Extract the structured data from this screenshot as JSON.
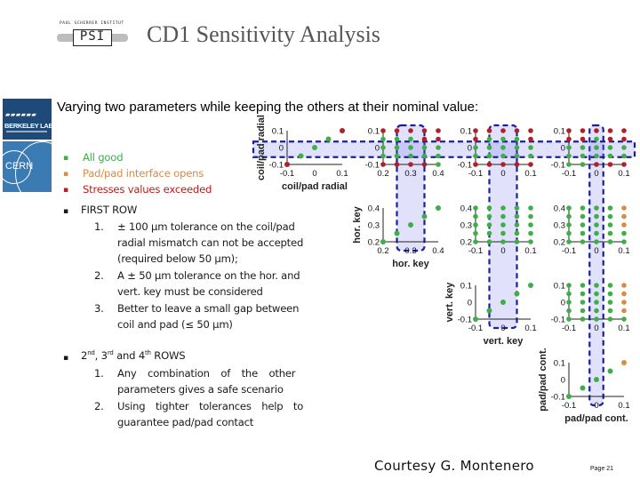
{
  "header": {
    "logo_top_text": "PAUL SCHERRER INSTITUT",
    "logo_mark": "PSI",
    "title": "CD1 Sensitivity Analysis"
  },
  "side_logos": {
    "berkeley": "BERKELEY LAB",
    "cern": "CERN"
  },
  "subtitle": "Varying two parameters while keeping the others at their nominal value:",
  "legend": [
    {
      "label": "All good",
      "color": "#3fae49"
    },
    {
      "label": "Pad/pad interface opens",
      "color": "#d98b45"
    },
    {
      "label": "Stresses values exceeded",
      "color": "#c01a1a"
    }
  ],
  "first_row": {
    "heading": "FIRST ROW",
    "items": [
      {
        "num": "1.",
        "lines": [
          "± 100 µm tolerance on the coil/pad",
          "radial mismatch can not be accepted",
          "(required below 50 µm);"
        ]
      },
      {
        "num": "2.",
        "lines": [
          "A ± 50 µm tolerance on the hor. and",
          "vert. key must be considered"
        ]
      },
      {
        "num": "3.",
        "lines": [
          "Better to leave a small gap between",
          "coil and pad (≤ 50 µm)"
        ]
      }
    ]
  },
  "other_rows": {
    "heading_parts": [
      "2",
      "nd",
      ", 3",
      "rd",
      " and 4",
      "th",
      " ROWS"
    ],
    "items": [
      {
        "num": "1.",
        "lines": [
          "Any combination of the other",
          "parameters gives a safe scenario"
        ]
      },
      {
        "num": "2.",
        "lines": [
          "Using tighter tolerances help to",
          "guarantee pad/pad contact"
        ]
      }
    ]
  },
  "courtesy": "Courtesy G. Montenero",
  "page": "Page 21",
  "chart_data": {
    "type": "scatter",
    "description": "Triangular matrix of 2-parameter sensitivity scans",
    "status_colors": {
      "good": "#3fae49",
      "open": "#d98b45",
      "stress": "#b0202a"
    },
    "parameters": [
      {
        "name": "coil/pad radial",
        "ticks": [
          "-0.1",
          "0",
          "0.1"
        ],
        "range": [
          -0.1,
          0.1
        ],
        "nominal_band": [
          -0.025,
          0.025
        ]
      },
      {
        "name": "hor. key",
        "ticks": [
          "0.2",
          "0.3",
          "0.4"
        ],
        "range": [
          0.2,
          0.4
        ],
        "nominal_band": [
          0.25,
          0.35
        ]
      },
      {
        "name": "vert. key",
        "ticks": [
          "-0.1",
          "0",
          "0.1"
        ],
        "range": [
          -0.1,
          0.1
        ],
        "nominal_band": [
          -0.05,
          0.05
        ]
      },
      {
        "name": "pad/pad cont.",
        "ticks": [
          "-0.1",
          "0",
          "0.1"
        ],
        "range": [
          -0.1,
          0.1
        ],
        "nominal_band": [
          -0.025,
          0.025
        ]
      }
    ],
    "diagonal": [
      {
        "param": 0,
        "status": [
          "stress",
          "good",
          "good",
          "good",
          "stress"
        ]
      },
      {
        "param": 1,
        "status": [
          "good",
          "good",
          "good",
          "good",
          "good"
        ]
      },
      {
        "param": 2,
        "status": [
          "good",
          "good",
          "good",
          "good",
          "good"
        ]
      },
      {
        "param": 3,
        "status": [
          "good",
          "good",
          "good",
          "good",
          "open"
        ]
      }
    ],
    "pairs": [
      {
        "row": 0,
        "col": 1,
        "grid": [
          [
            "stress",
            "stress",
            "stress",
            "stress",
            "stress"
          ],
          [
            "good",
            "good",
            "good",
            "stress",
            "stress"
          ],
          [
            "good",
            "good",
            "good",
            "good",
            "good"
          ],
          [
            "good",
            "good",
            "good",
            "good",
            "good"
          ],
          [
            "stress",
            "stress",
            "stress",
            "stress",
            "good"
          ]
        ]
      },
      {
        "row": 0,
        "col": 2,
        "grid": [
          [
            "stress",
            "stress",
            "stress",
            "stress",
            "stress"
          ],
          [
            "stress",
            "good",
            "good",
            "good",
            "stress"
          ],
          [
            "good",
            "good",
            "good",
            "good",
            "good"
          ],
          [
            "good",
            "good",
            "good",
            "good",
            "good"
          ],
          [
            "stress",
            "stress",
            "stress",
            "stress",
            "stress"
          ]
        ]
      },
      {
        "row": 0,
        "col": 3,
        "grid": [
          [
            "stress",
            "stress",
            "stress",
            "stress",
            "stress"
          ],
          [
            "stress",
            "stress",
            "good",
            "stress",
            "stress"
          ],
          [
            "good",
            "good",
            "good",
            "good",
            "good"
          ],
          [
            "good",
            "good",
            "good",
            "good",
            "good"
          ],
          [
            "good",
            "good",
            "stress",
            "stress",
            "stress"
          ]
        ]
      },
      {
        "row": 1,
        "col": 2,
        "grid": [
          [
            "good",
            "good",
            "good",
            "good",
            "good"
          ],
          [
            "good",
            "good",
            "good",
            "good",
            "good"
          ],
          [
            "good",
            "good",
            "good",
            "good",
            "good"
          ],
          [
            "good",
            "good",
            "good",
            "good",
            "good"
          ],
          [
            "good",
            "good",
            "good",
            "good",
            "good"
          ]
        ]
      },
      {
        "row": 1,
        "col": 3,
        "grid": [
          [
            "good",
            "good",
            "good",
            "good",
            "open"
          ],
          [
            "good",
            "good",
            "good",
            "good",
            "open"
          ],
          [
            "good",
            "good",
            "good",
            "good",
            "open"
          ],
          [
            "good",
            "good",
            "good",
            "good",
            "good"
          ],
          [
            "good",
            "good",
            "good",
            "good",
            "good"
          ]
        ]
      },
      {
        "row": 2,
        "col": 3,
        "grid": [
          [
            "good",
            "good",
            "good",
            "good",
            "open"
          ],
          [
            "good",
            "good",
            "good",
            "good",
            "open"
          ],
          [
            "good",
            "good",
            "good",
            "good",
            "open"
          ],
          [
            "good",
            "good",
            "good",
            "good",
            "open"
          ],
          [
            "good",
            "good",
            "good",
            "good",
            "good"
          ]
        ]
      }
    ]
  }
}
